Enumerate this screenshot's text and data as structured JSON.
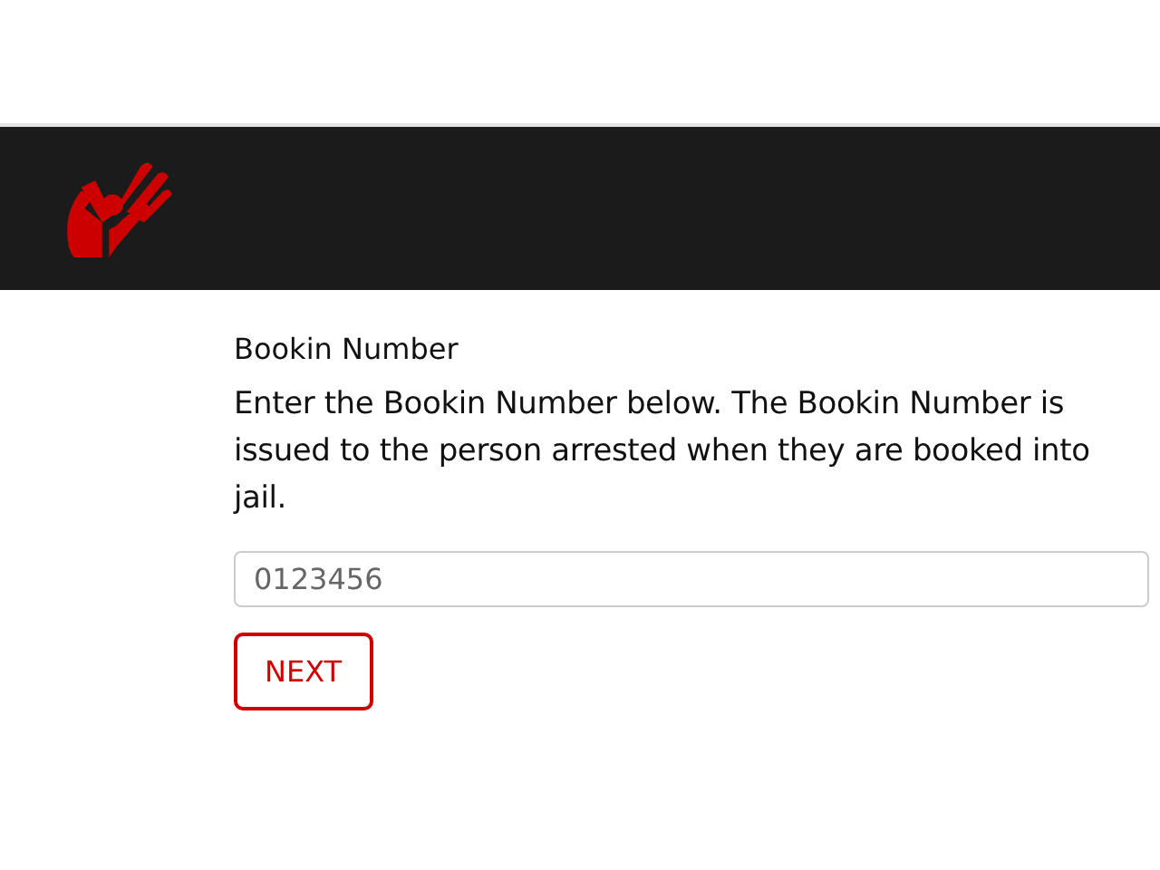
{
  "form": {
    "title": "Bookin Number",
    "description": "Enter the Bookin Number below. The Bookin Number is issued to the person arrested when they are booked into jail.",
    "field": {
      "placeholder": "0123456"
    },
    "button": "NEXT"
  }
}
